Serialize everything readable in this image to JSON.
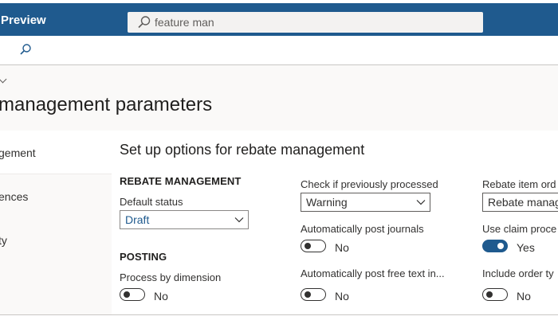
{
  "app": {
    "title": "Preview"
  },
  "search": {
    "value": "feature man"
  },
  "page": {
    "title": "management parameters"
  },
  "nav": {
    "items": [
      {
        "label": "gement"
      },
      {
        "label": "ences"
      },
      {
        "label": "ty"
      }
    ]
  },
  "panel": {
    "title": "Set up options for rebate management",
    "rebate_section": "REBATE MANAGEMENT",
    "posting_section": "POSTING",
    "default_status": {
      "label": "Default status",
      "value": "Draft"
    },
    "process_by_dimension": {
      "label": "Process by dimension",
      "value": "No",
      "on": false
    },
    "check_processed": {
      "label": "Check if previously processed",
      "value": "Warning"
    },
    "auto_post_journals": {
      "label": "Automatically post journals",
      "value": "No",
      "on": false
    },
    "auto_post_free_text": {
      "label": "Automatically post free text in...",
      "value": "No",
      "on": false
    },
    "rebate_item": {
      "label": "Rebate item ord",
      "value": "Rebate manag"
    },
    "use_claim": {
      "label": "Use claim proce",
      "value": "Yes",
      "on": true
    },
    "include_order": {
      "label": "Include order ty",
      "value": "No",
      "on": false
    }
  },
  "colors": {
    "brand": "#1f5a8e",
    "page_bg": "#faf9f8"
  },
  "icons": {
    "search": "search-icon",
    "chevron": "chevron-down-icon"
  }
}
